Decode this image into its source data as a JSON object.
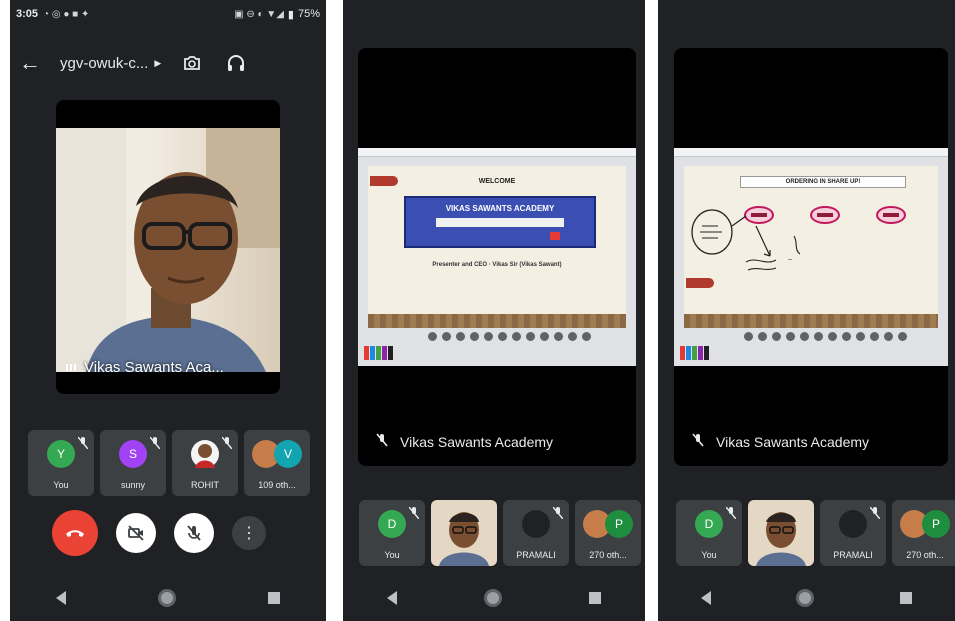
{
  "phone1": {
    "status": {
      "time": "3:05",
      "battery": "75%"
    },
    "meeting_code": "ygv-owuk-c...",
    "main_speaker": "Vikas Sawants Aca...",
    "participants": [
      {
        "initial": "Y",
        "name": "You",
        "color": "#34a853"
      },
      {
        "initial": "S",
        "name": "sunny",
        "color": "#a142f4"
      },
      {
        "initial": "",
        "name": "ROHIT",
        "color": "#5f6368"
      },
      {
        "initial": "V",
        "name": "109 oth...",
        "color": "#12a4af"
      }
    ],
    "more_label": "⋮"
  },
  "phone2": {
    "slide_welcome": "WELCOME",
    "slide_title": "VIKAS SAWANTS ACADEMY",
    "slide_footer": "Presenter and CEO · Vikas Sir (Vikas Sawant)",
    "presenter_name": "Vikas Sawants Academy",
    "participants": [
      {
        "initial": "D",
        "name": "You",
        "color": "#34a853"
      },
      {
        "initial": "",
        "name": "",
        "color": ""
      },
      {
        "initial": "",
        "name": "PRAMALI",
        "color": "#202124"
      },
      {
        "initial": "P",
        "name": "270 oth...",
        "color": "#1e8e3e"
      }
    ]
  },
  "phone3": {
    "slide_header": "ORDERING IN SHARE UP!",
    "presenter_name": "Vikas Sawants Academy",
    "participants": [
      {
        "initial": "D",
        "name": "You",
        "color": "#34a853"
      },
      {
        "initial": "",
        "name": "",
        "color": ""
      },
      {
        "initial": "",
        "name": "PRAMALI",
        "color": "#202124"
      },
      {
        "initial": "P",
        "name": "270 oth...",
        "color": "#1e8e3e"
      }
    ]
  },
  "colors": {
    "end_call": "#ea4335",
    "background": "#202124",
    "tile": "#3c4043"
  }
}
